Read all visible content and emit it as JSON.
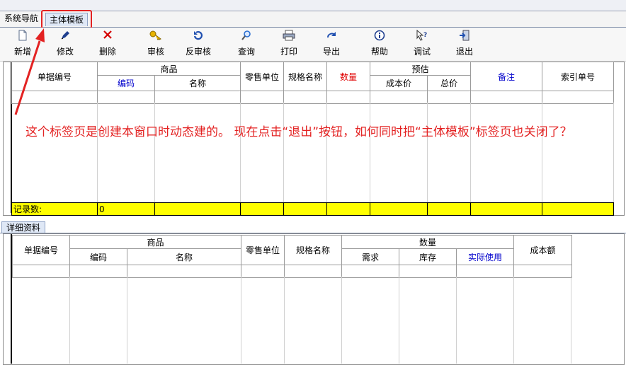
{
  "tabs": {
    "nav": "系统导航",
    "main": "主体模板"
  },
  "toolbar": {
    "new": "新增",
    "edit": "修改",
    "delete": "删除",
    "audit": "审核",
    "unaudit": "反审核",
    "query": "查询",
    "print": "打印",
    "export": "导出",
    "help": "帮助",
    "debug": "调试",
    "exit": "退出"
  },
  "upper": {
    "col_doc_no": "单据编号",
    "group_goods": "商品",
    "col_code": "编码",
    "col_name": "名称",
    "col_unit": "零售单位",
    "col_spec": "规格名称",
    "col_qty": "数量",
    "group_est": "预估",
    "col_cost": "成本价",
    "col_total": "总价",
    "col_note": "备注",
    "col_index": "索引单号",
    "record_label": "记录数:",
    "record_count": "0"
  },
  "detail": {
    "tab": "详细资料",
    "col_doc_no": "单据编号",
    "group_goods": "商品",
    "col_code": "编码",
    "col_name": "名称",
    "col_unit": "零售单位",
    "col_spec": "规格名称",
    "group_qty": "数量",
    "col_demand": "需求",
    "col_stock": "库存",
    "col_actual": "实际使用",
    "col_cost_amount": "成本额"
  },
  "annotation": "这个标签页是创建本窗口时动态建的。 现在点击“退出”按钮，如何同时把“主体模板”标签页也关闭了？"
}
